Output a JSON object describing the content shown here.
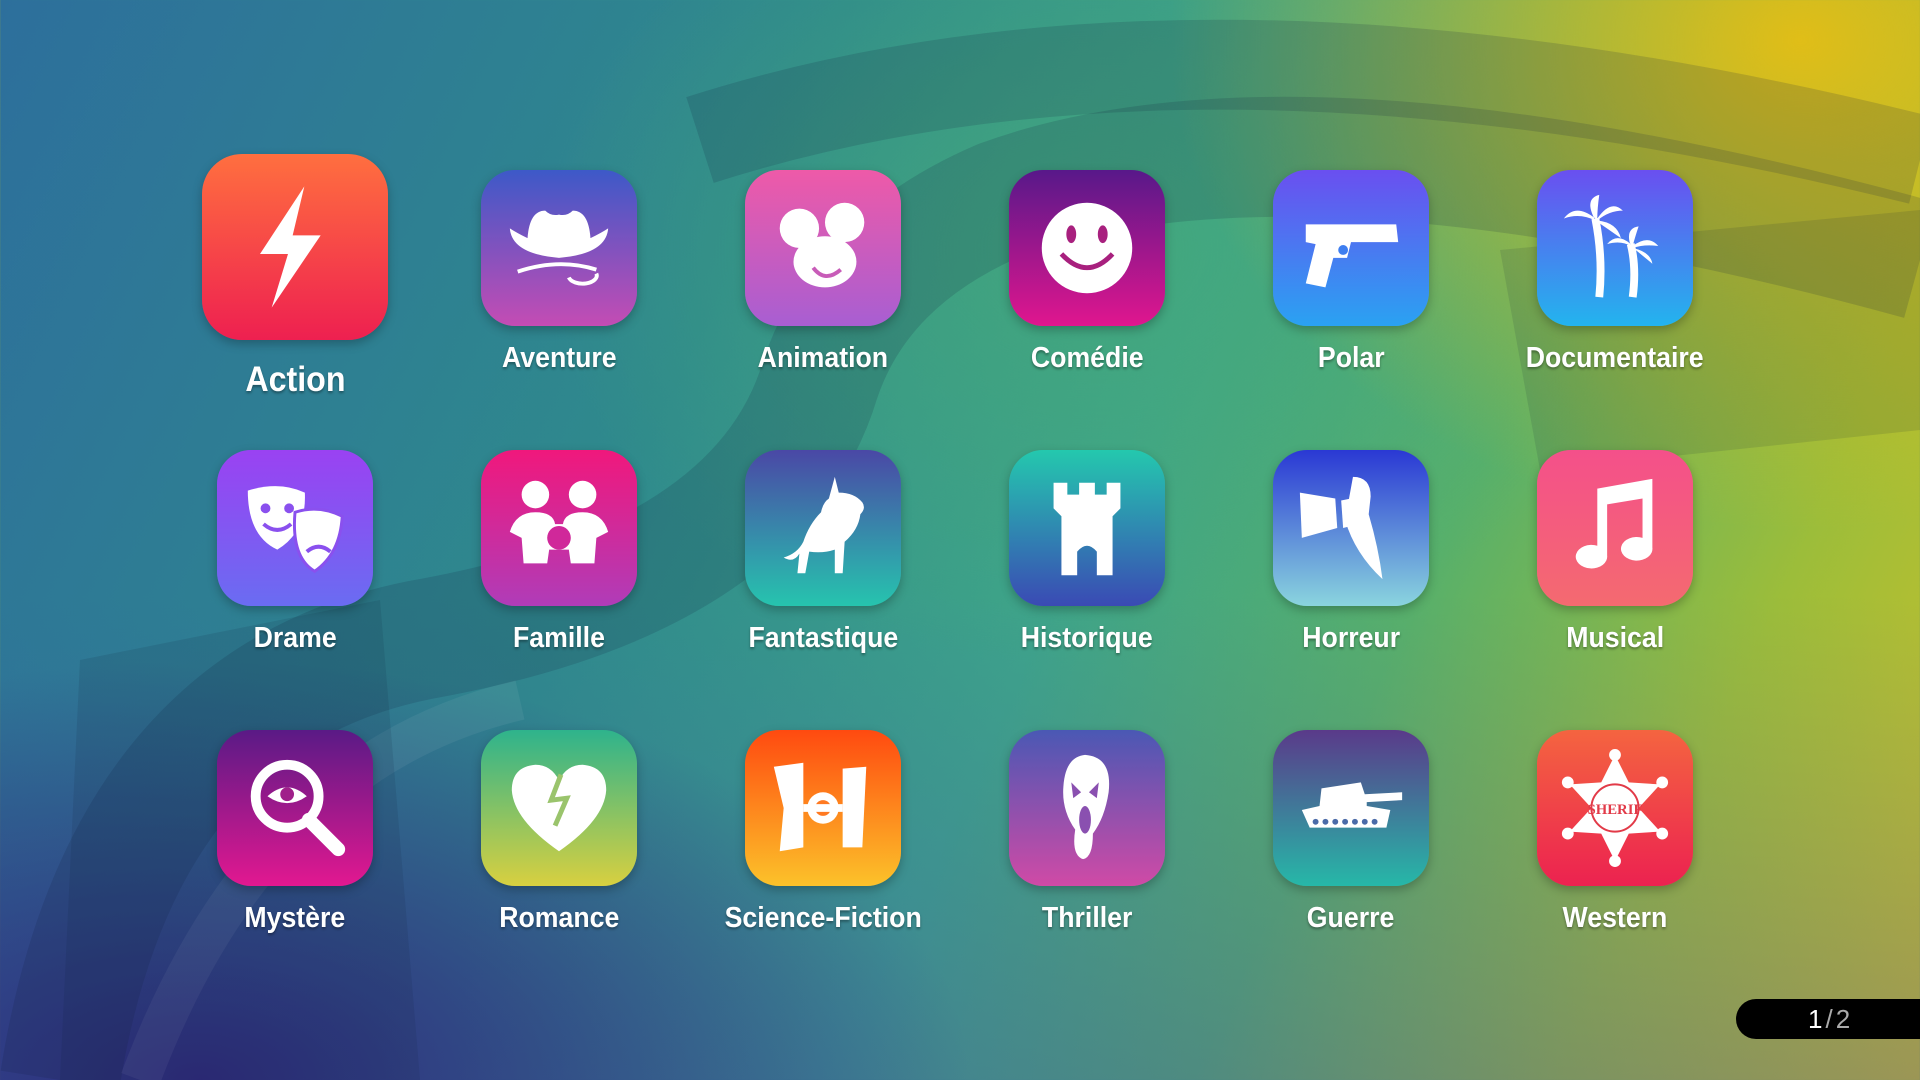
{
  "genres": [
    {
      "label": "Action",
      "icon": "lightning-icon",
      "top": "#ff6f3f",
      "bottom": "#ee2050"
    },
    {
      "label": "Aventure",
      "icon": "cowboy-hat-icon",
      "top": "#3d59c8",
      "bottom": "#c44cb4"
    },
    {
      "label": "Animation",
      "icon": "mouse-ears-icon",
      "top": "#ee5aa8",
      "bottom": "#a85ed2"
    },
    {
      "label": "Comédie",
      "icon": "smiley-icon",
      "top": "#58188a",
      "bottom": "#e0168e"
    },
    {
      "label": "Polar",
      "icon": "pistol-icon",
      "top": "#6a4ff0",
      "bottom": "#2aa2f2"
    },
    {
      "label": "Documentaire",
      "icon": "palm-trees-icon",
      "top": "#6a4ff0",
      "bottom": "#23b4ee"
    },
    {
      "label": "Drame",
      "icon": "theater-masks-icon",
      "top": "#9a42f2",
      "bottom": "#6a6cf2"
    },
    {
      "label": "Famille",
      "icon": "family-icon",
      "top": "#f0187c",
      "bottom": "#b03cb8"
    },
    {
      "label": "Fantastique",
      "icon": "unicorn-icon",
      "top": "#4a48a6",
      "bottom": "#26c4ae"
    },
    {
      "label": "Historique",
      "icon": "tower-icon",
      "top": "#24c8ae",
      "bottom": "#3a4ab4"
    },
    {
      "label": "Horreur",
      "icon": "knife-icon",
      "top": "#2a38d4",
      "bottom": "#8ad4de"
    },
    {
      "label": "Musical",
      "icon": "music-note-icon",
      "top": "#f4508a",
      "bottom": "#f46a70"
    },
    {
      "label": "Mystère",
      "icon": "magnifier-eye-icon",
      "top": "#5a1a86",
      "bottom": "#e21890"
    },
    {
      "label": "Romance",
      "icon": "broken-heart-icon",
      "top": "#2eb38c",
      "bottom": "#d8d040"
    },
    {
      "label": "Science-Fiction",
      "icon": "tie-fighter-icon",
      "top": "#ff4a10",
      "bottom": "#fcc22a"
    },
    {
      "label": "Thriller",
      "icon": "ghost-mask-icon",
      "top": "#4a58b4",
      "bottom": "#d04aa6"
    },
    {
      "label": "Guerre",
      "icon": "tank-icon",
      "top": "#5a3a8a",
      "bottom": "#26b8a8"
    },
    {
      "label": "Western",
      "icon": "sheriff-star-icon",
      "top": "#f46440",
      "bottom": "#ec2250"
    }
  ],
  "badge_text": "SHERIF",
  "pager": {
    "current": "1",
    "separator": "/",
    "total": "2"
  }
}
